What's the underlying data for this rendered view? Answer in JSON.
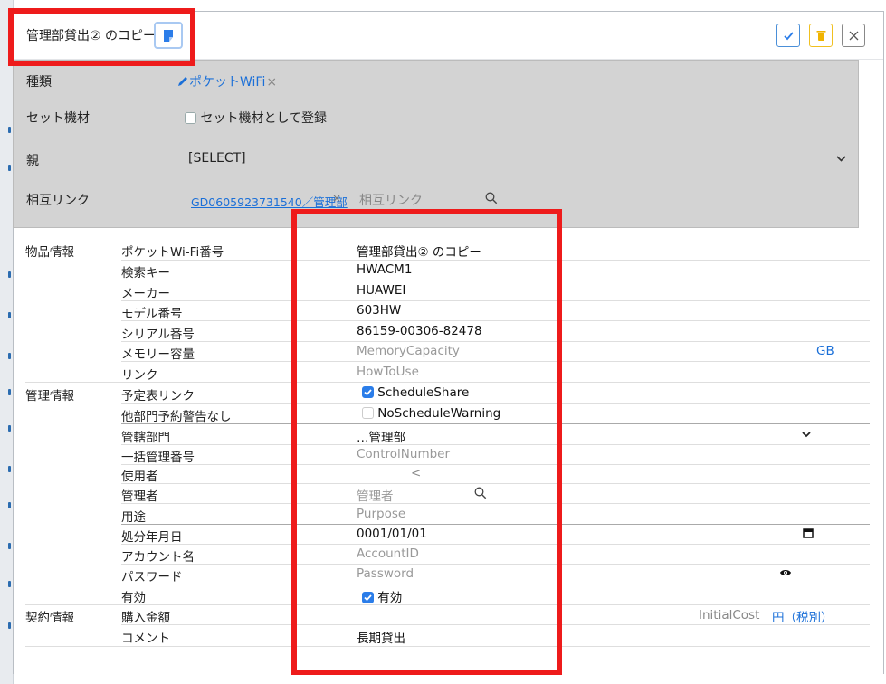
{
  "title": "管理部貸出② のコピー",
  "icons": {
    "copy": "copy-icon",
    "confirm": "check-icon",
    "delete": "trash-icon",
    "close": "close-icon"
  },
  "colors": {
    "accent": "#2b7de9",
    "highlight": "#ee1b1b",
    "delete": "#f0c020"
  },
  "top_fields": {
    "kind_label": "種類",
    "kind_value": "ポケットWiFi",
    "kind_remove": "×",
    "set_label": "セット機材",
    "set_checkbox_label": "セット機材として登録",
    "parent_label": "親",
    "parent_value": "[SELECT]",
    "mutual_label": "相互リンク",
    "mutual_chip": "GD0605923731540／管理部",
    "mutual_chip_remove": "×",
    "mutual_placeholder": "相互リンク"
  },
  "sections": {
    "item": "物品情報",
    "management": "管理情報",
    "contract": "契約情報"
  },
  "fields": [
    {
      "label": "ポケットWi-Fi番号",
      "value": "管理部貸出② のコピー"
    },
    {
      "label": "検索キー",
      "value": "HWACM1"
    },
    {
      "label": "メーカー",
      "value": "HUAWEI"
    },
    {
      "label": "モデル番号",
      "value": "603HW"
    },
    {
      "label": "シリアル番号",
      "value": "86159-00306-82478"
    },
    {
      "label": "メモリー容量",
      "value": "MemoryCapacity"
    },
    {
      "label": "リンク",
      "value": "HowToUse"
    },
    {
      "label": "予定表リンク",
      "value": "ScheduleShare"
    },
    {
      "label": "他部門予約警告なし",
      "value": "NoScheduleWarning"
    },
    {
      "label": "管轄部門",
      "value": "…管理部"
    },
    {
      "label": "一括管理番号",
      "value": "ControlNumber"
    },
    {
      "label": "使用者",
      "value": "<"
    },
    {
      "label": "管理者",
      "value": "管理者"
    },
    {
      "label": "用途",
      "value": "Purpose"
    },
    {
      "label": "処分年月日",
      "value": "0001/01/01"
    },
    {
      "label": "アカウント名",
      "value": "AccountID"
    },
    {
      "label": "パスワード",
      "value": "Password"
    },
    {
      "label": "有効",
      "value": "有効"
    },
    {
      "label": "購入金額",
      "value": ""
    },
    {
      "label": "コメント",
      "value": "長期貸出"
    }
  ],
  "memory_unit": "GB",
  "initial_cost_placeholder": "InitialCost",
  "cost_unit": "円（税別）",
  "checkbox_states": {
    "schedule_share": true,
    "no_schedule_warning": false,
    "enabled": true,
    "set_equipment": false
  }
}
